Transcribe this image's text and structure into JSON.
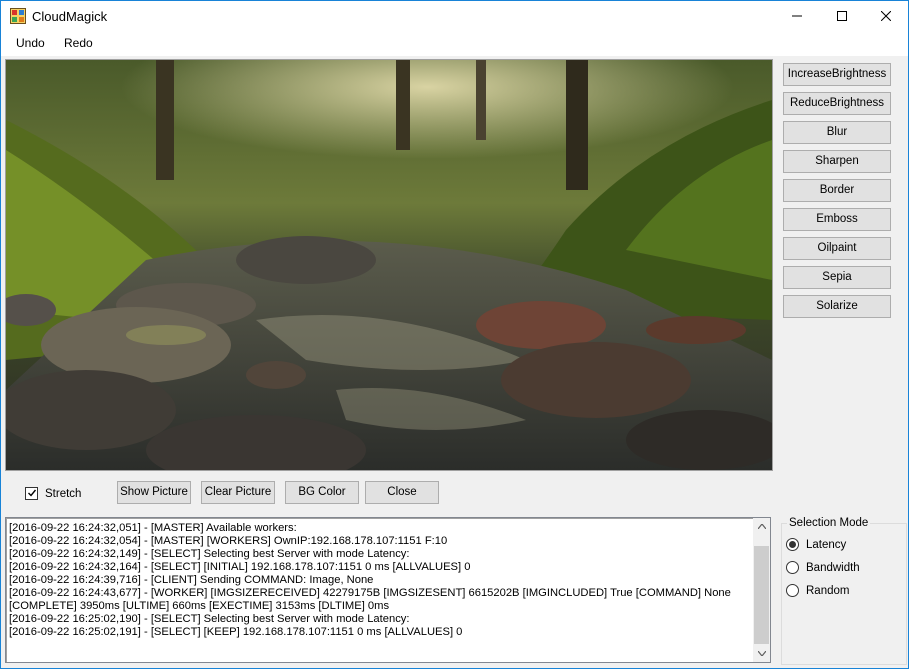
{
  "window": {
    "title": "CloudMagick"
  },
  "menu": {
    "items": [
      "Undo",
      "Redo"
    ]
  },
  "image_area": {
    "description_icon": "photo-stream-rocks"
  },
  "side_buttons": [
    "IncreaseBrightness",
    "ReduceBrightness",
    "Blur",
    "Sharpen",
    "Border",
    "Emboss",
    "Oilpaint",
    "Sepia",
    "Solarize"
  ],
  "controls": {
    "stretch_label": "Stretch",
    "stretch_checked": true,
    "show_picture": "Show Picture",
    "clear_picture": "Clear Picture",
    "bg_color": "BG Color",
    "close": "Close"
  },
  "log": {
    "lines": [
      "[2016-09-22 16:24:32,051] - [MASTER] Available workers:",
      "[2016-09-22 16:24:32,054] - [MASTER] [WORKERS] OwnIP:192.168.178.107:1151 F:10",
      "[2016-09-22 16:24:32,149] - [SELECT] Selecting best Server with mode Latency:",
      "[2016-09-22 16:24:32,164] - [SELECT] [INITIAL] 192.168.178.107:1151 0 ms [ALLVALUES] 0",
      "[2016-09-22 16:24:39,716] - [CLIENT] Sending COMMAND: Image, None",
      "[2016-09-22 16:24:43,677] - [WORKER] [IMGSIZERECEIVED] 42279175B [IMGSIZESENT] 6615202B [IMGINCLUDED] True [COMMAND] None",
      "[COMPLETE] 3950ms [ULTIME] 660ms [EXECTIME] 3153ms [DLTIME] 0ms",
      "[2016-09-22 16:25:02,190] - [SELECT] Selecting best Server with mode Latency:",
      "[2016-09-22 16:25:02,191] - [SELECT] [KEEP] 192.168.178.107:1151 0 ms [ALLVALUES] 0"
    ]
  },
  "selection_mode": {
    "title": "Selection Mode",
    "options": [
      "Latency",
      "Bandwidth",
      "Random"
    ],
    "selected": "Latency"
  },
  "colors": {
    "window_border": "#1883d7",
    "button_face": "#e1e1e1",
    "button_border": "#adadad",
    "background": "#f0f0f0"
  }
}
